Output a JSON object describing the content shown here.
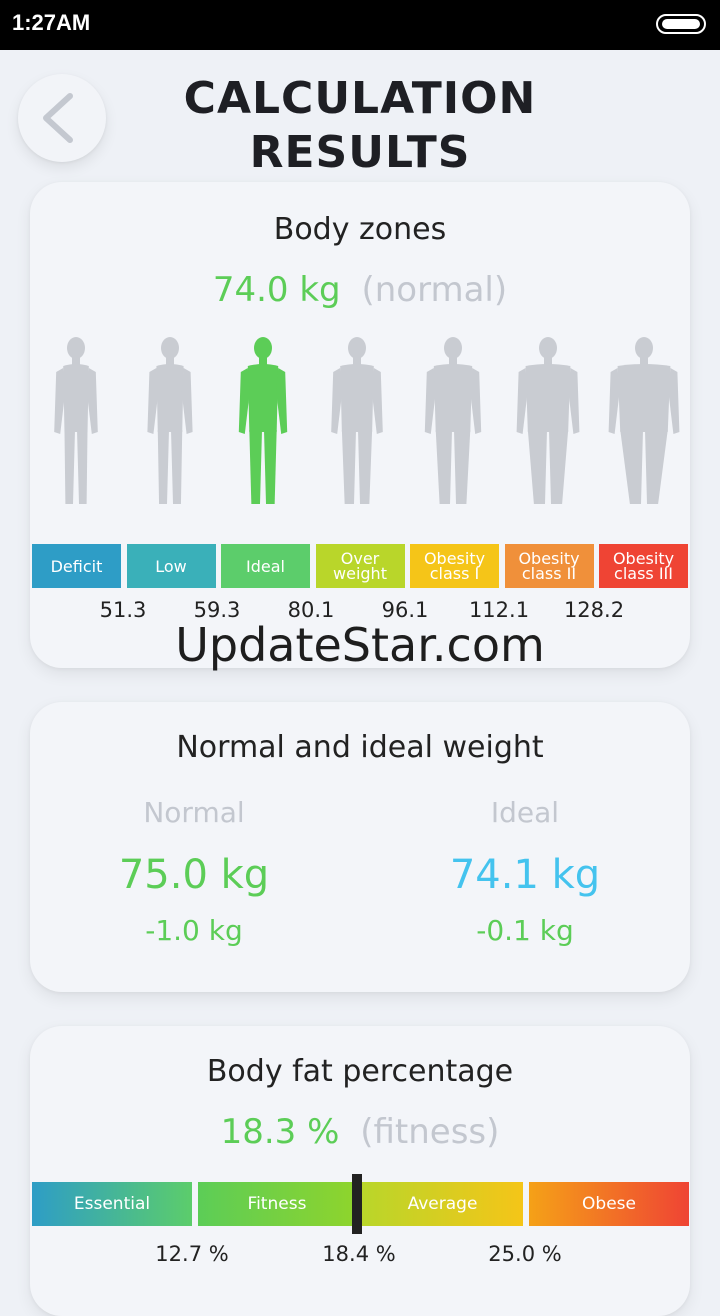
{
  "status_bar": {
    "time": "1:27AM"
  },
  "header": {
    "title_line1": "CALCULATION",
    "title_line2": "RESULTS"
  },
  "body_zones": {
    "title": "Body zones",
    "value": "74.0 kg",
    "status": "(normal)",
    "selected_index": 2,
    "zones": [
      {
        "label_line1": "Deficit",
        "label_line2": "",
        "color": "#2e9dc6"
      },
      {
        "label_line1": "Low",
        "label_line2": "",
        "color": "#3ab0b9"
      },
      {
        "label_line1": "Ideal",
        "label_line2": "",
        "color": "#5ccd6b"
      },
      {
        "label_line1": "Over",
        "label_line2": "weight",
        "color": "#b9d62a"
      },
      {
        "label_line1": "Obesity",
        "label_line2": "class I",
        "color": "#f5c518"
      },
      {
        "label_line1": "Obesity",
        "label_line2": "class II",
        "color": "#f0903a"
      },
      {
        "label_line1": "Obesity",
        "label_line2": "class III",
        "color": "#ef4434"
      }
    ],
    "thresholds": [
      "51.3",
      "59.3",
      "80.1",
      "96.1",
      "112.1",
      "128.2"
    ],
    "watermark": "UpdateStar.com"
  },
  "weights": {
    "title": "Normal and ideal weight",
    "normal": {
      "label": "Normal",
      "value": "75.0 kg",
      "diff": "-1.0 kg"
    },
    "ideal": {
      "label": "Ideal",
      "value": "74.1 kg",
      "diff": "-0.1 kg"
    }
  },
  "body_fat": {
    "title": "Body fat percentage",
    "value": "18.3 %",
    "status": "(fitness)",
    "segments": [
      {
        "label": "Essential"
      },
      {
        "label": "Fitness"
      },
      {
        "label": "Average"
      },
      {
        "label": "Obese"
      }
    ],
    "thresholds": [
      "12.7 %",
      "18.4 %",
      "25.0 %"
    ]
  },
  "colors": {
    "accent_green": "#5ccd57",
    "accent_blue": "#44c3ee",
    "figure_gray": "#c9ccd2"
  }
}
